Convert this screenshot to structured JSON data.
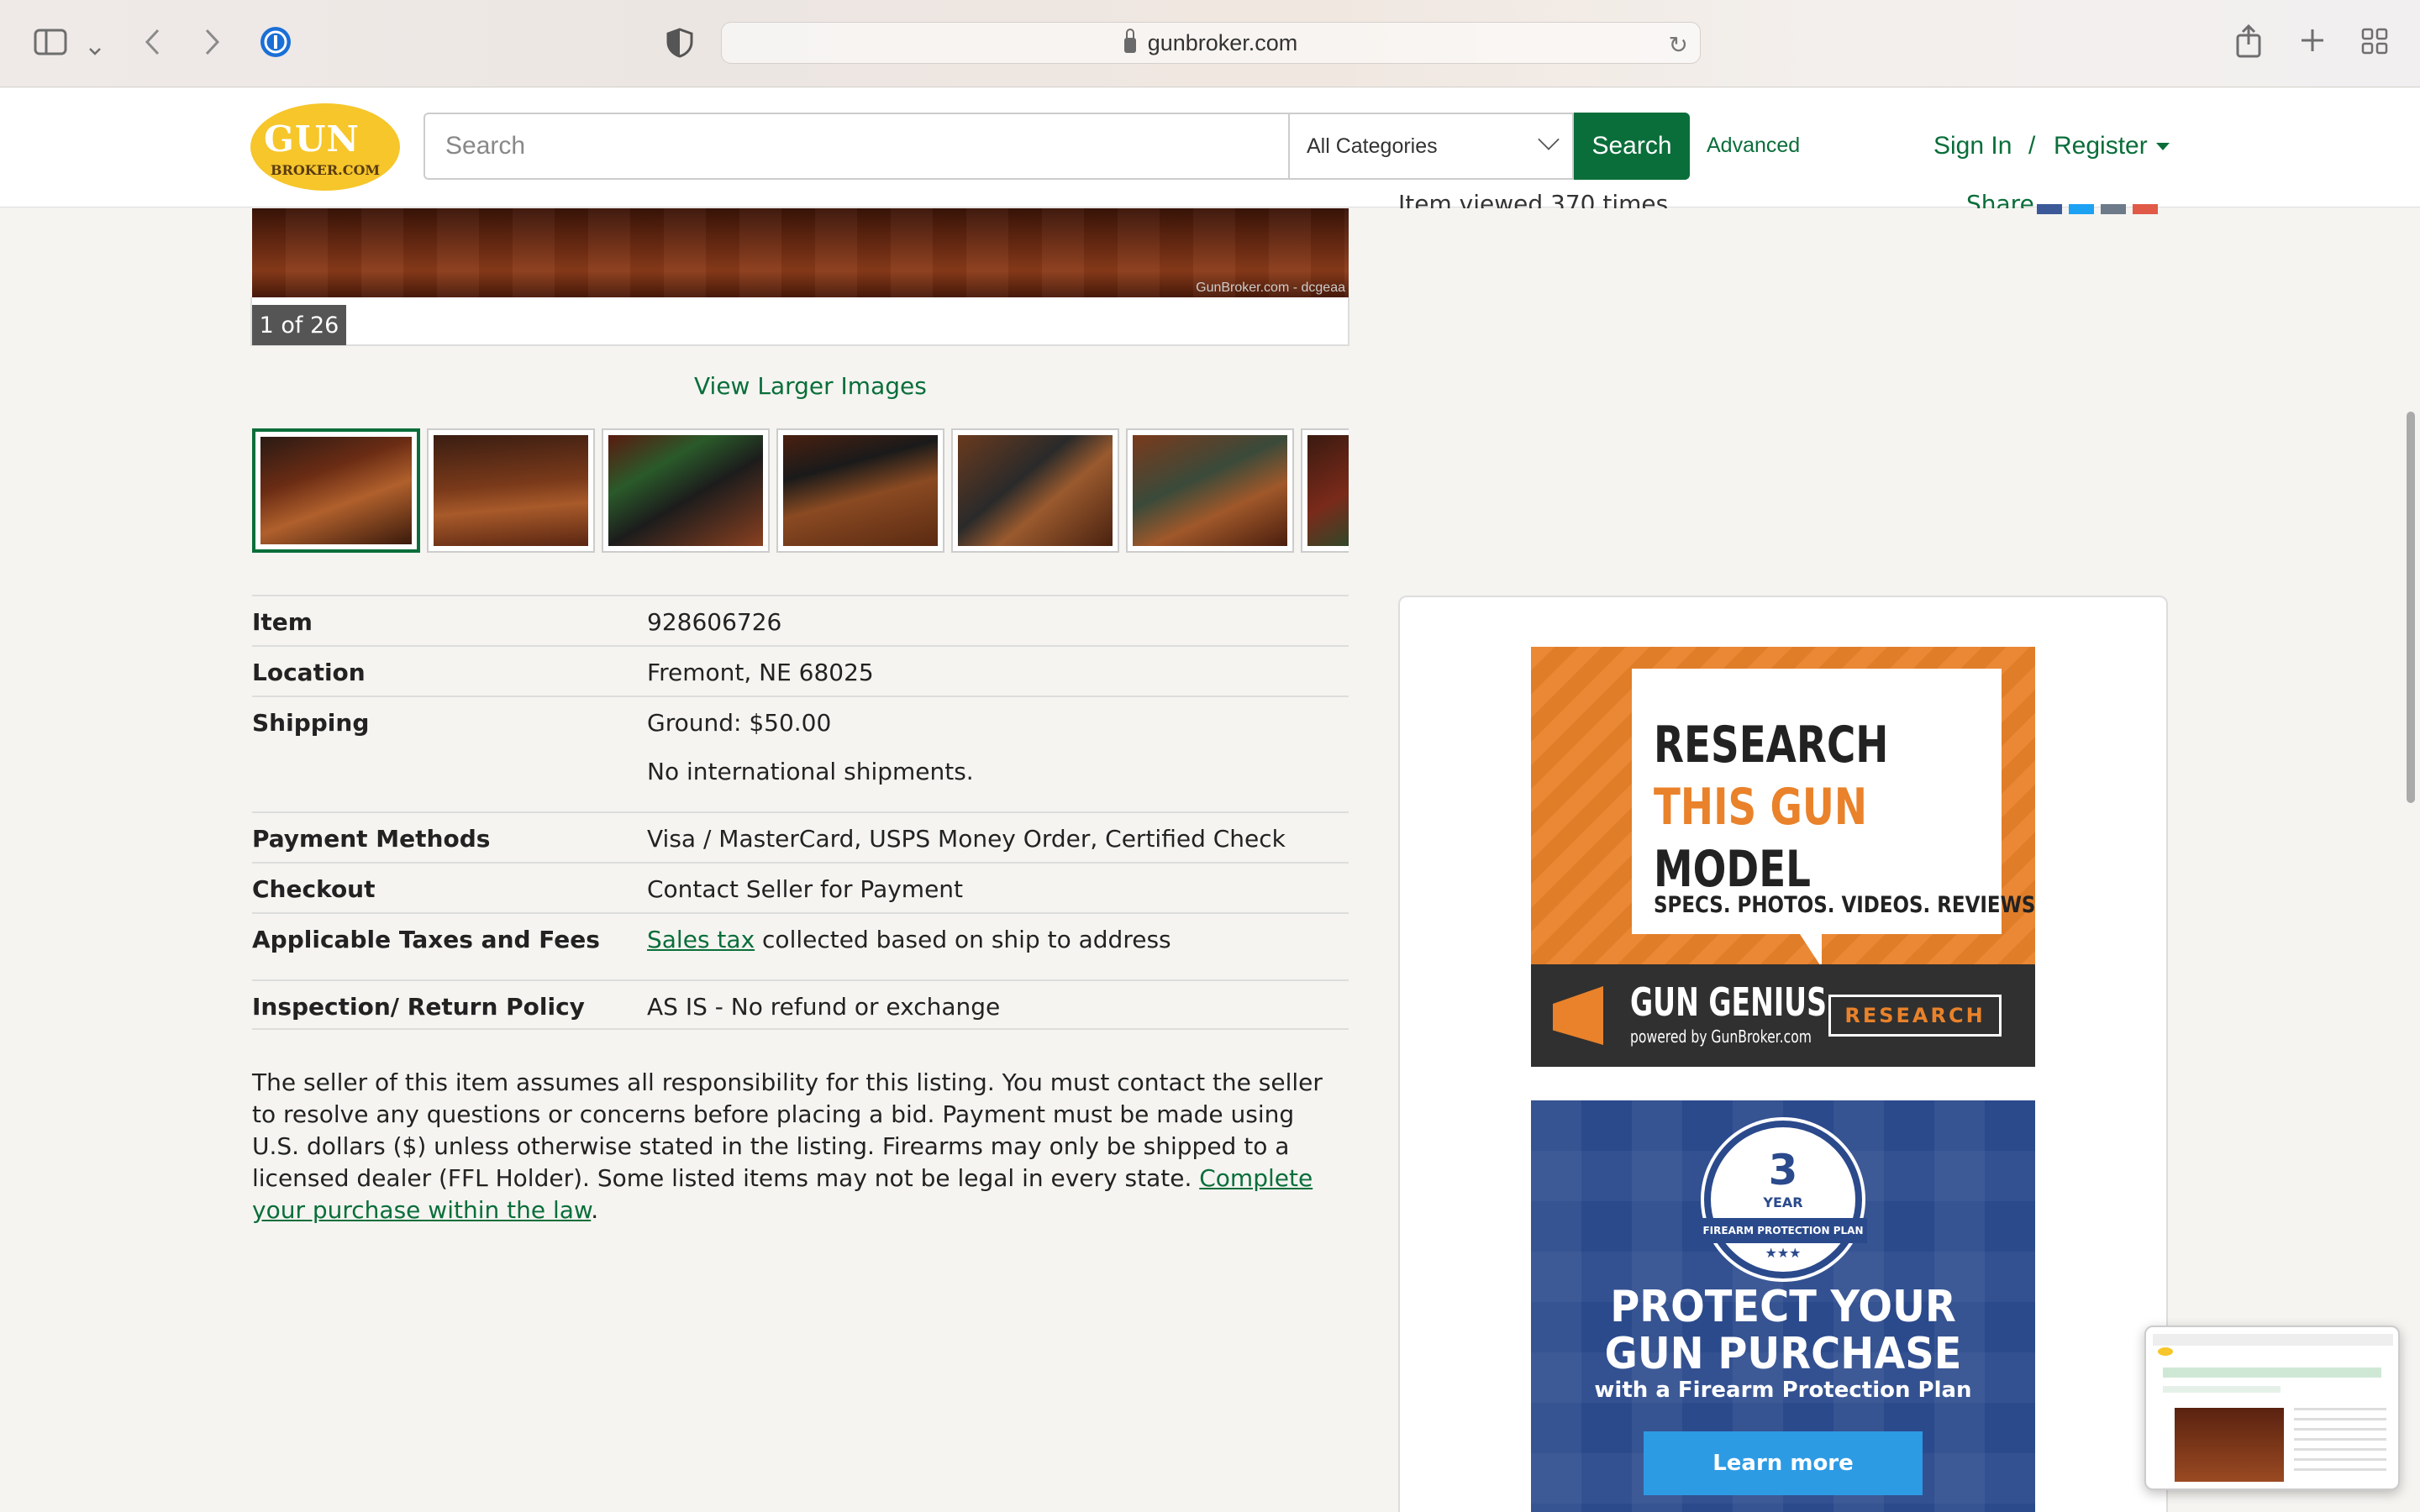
{
  "browser": {
    "url": "gunbroker.com",
    "icons": [
      "sidebar-icon",
      "chevron-down-icon",
      "back-icon",
      "forward-icon",
      "password-manager-icon",
      "privacy-shield-icon",
      "lock-icon",
      "reload-icon",
      "share-icon",
      "new-tab-icon",
      "tab-overview-icon"
    ]
  },
  "header": {
    "logo_line1": "GUN",
    "logo_line2": "BROKER.COM",
    "search_placeholder": "Search",
    "category_selected": "All Categories",
    "search_button": "Search",
    "advanced_link": "Advanced",
    "sign_in": "Sign In",
    "separator": "/",
    "register": "Register"
  },
  "gallery": {
    "watermark": "GunBroker.com - dcgeaa",
    "counter": "1 of 26",
    "view_larger": "View Larger Images",
    "thumbnail_count_visible": 7,
    "active_thumbnail": 1
  },
  "details": {
    "rows": [
      {
        "label": "Item",
        "value": "928606726"
      },
      {
        "label": "Location",
        "value": "Fremont, NE 68025"
      },
      {
        "label": "Shipping",
        "value": "Ground: $50.00",
        "value2": "No international shipments."
      },
      {
        "label": "Payment Methods",
        "value": "Visa / MasterCard, USPS Money Order, Certified Check"
      },
      {
        "label": "Checkout",
        "value": "Contact Seller for Payment"
      },
      {
        "label": "Applicable Taxes and Fees",
        "link": "Sales tax",
        "value": " collected based on ship to address"
      },
      {
        "label": "Inspection/ Return Policy",
        "value": "AS IS - No refund or exchange"
      }
    ]
  },
  "disclaimer": {
    "text": "The seller of this item assumes all responsibility for this listing. You must contact the seller to resolve any questions or concerns before placing a bid. Payment must be made using U.S. dollars ($) unless otherwise stated in the listing. Firearms may only be shipped to a licensed dealer (FFL Holder). Some listed items may not be legal in every state. ",
    "link": "Complete your purchase within the law",
    "end": "."
  },
  "sidebar": {
    "viewed_text": "Item viewed 370 times.",
    "share_label": "Share",
    "share_colors": [
      "#3b5998",
      "#1da1f2",
      "#6c7a89",
      "#e05a47"
    ]
  },
  "ads": {
    "research": {
      "line1": "RESEARCH",
      "line2": "THIS GUN",
      "line3": "MODEL",
      "sub": "SPECS. PHOTOS. VIDEOS. REVIEWS.",
      "brand": "GUN GENIUS",
      "powered": "powered by GunBroker.com",
      "button": "RESEARCH"
    },
    "protect": {
      "badge_number": "3",
      "badge_year": "YEAR",
      "badge_band": "FIREARM PROTECTION PLAN",
      "badge_stars": "★★★",
      "line1": "PROTECT YOUR",
      "line2": "GUN PURCHASE",
      "sub": "with a Firearm Protection Plan",
      "button": "Learn more"
    }
  },
  "colors": {
    "brand_green": "#0a6e3a",
    "logo_yellow": "#f6c62a",
    "ad_orange": "#e9822a",
    "ad_blue": "#2b4a8c"
  }
}
